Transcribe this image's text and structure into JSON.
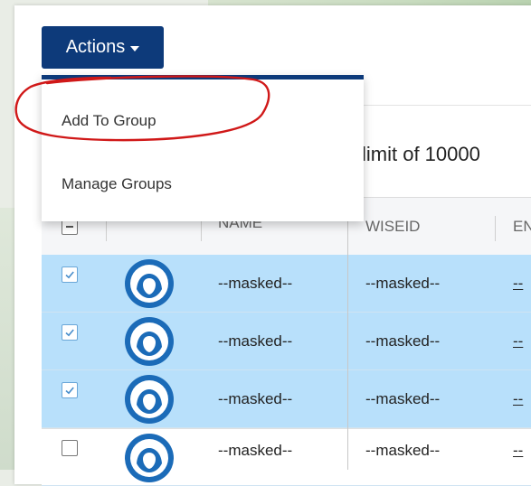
{
  "toolbar": {
    "actions_label": "Actions",
    "caret_icon": "caret-down-icon"
  },
  "dropdown": {
    "items": [
      {
        "label": "Add To Group"
      },
      {
        "label": "Manage Groups"
      }
    ]
  },
  "limit_text": "limit of 10000",
  "table": {
    "columns": [
      "-->",
      "NAME",
      "WISEID",
      "EN"
    ],
    "rows": [
      {
        "checked": true,
        "name": "--masked--",
        "wiseid": "--masked--",
        "extra": "--"
      },
      {
        "checked": true,
        "name": "--masked--",
        "wiseid": "--masked--",
        "extra": "--"
      },
      {
        "checked": true,
        "name": "--masked--",
        "wiseid": "--masked--",
        "extra": "--"
      },
      {
        "checked": false,
        "name": "--masked--",
        "wiseid": "--masked--",
        "extra": "--"
      }
    ]
  },
  "colors": {
    "primary": "#0d3a7a",
    "selected_row": "#b8e0fb",
    "annotation": "#d01818",
    "avatar": "#1b6bb8"
  }
}
